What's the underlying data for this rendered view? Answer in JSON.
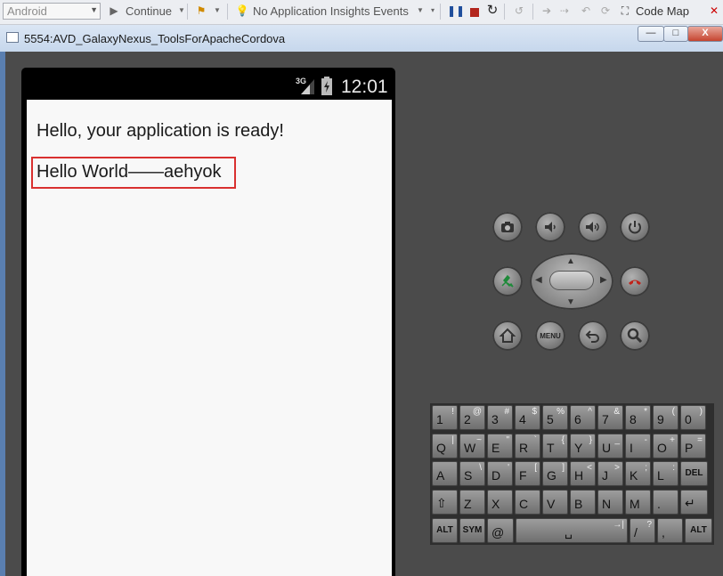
{
  "toolbar": {
    "platform": "Android",
    "continue_label": "Continue",
    "insights_label": "No Application Insights Events",
    "code_map_label": "Code Map"
  },
  "window": {
    "title": "5554:AVD_GalaxyNexus_ToolsForApacheCordova",
    "minimize": "—",
    "maximize": "□",
    "close": "X"
  },
  "device": {
    "network": "3G",
    "time": "12:01",
    "line1": "Hello, your application is ready!",
    "line2": "Hello World——aehyok"
  },
  "controls": {
    "menu": "MENU"
  },
  "keyboard": {
    "rows": [
      [
        {
          "m": "1",
          "s": "!"
        },
        {
          "m": "2",
          "s": "@"
        },
        {
          "m": "3",
          "s": "#"
        },
        {
          "m": "4",
          "s": "$"
        },
        {
          "m": "5",
          "s": "%"
        },
        {
          "m": "6",
          "s": "^"
        },
        {
          "m": "7",
          "s": "&"
        },
        {
          "m": "8",
          "s": "*"
        },
        {
          "m": "9",
          "s": "("
        },
        {
          "m": "0",
          "s": ")"
        }
      ],
      [
        {
          "m": "Q",
          "s": "|"
        },
        {
          "m": "W",
          "s": "~"
        },
        {
          "m": "E",
          "s": "\""
        },
        {
          "m": "R",
          "s": "`"
        },
        {
          "m": "T",
          "s": "{"
        },
        {
          "m": "Y",
          "s": "}"
        },
        {
          "m": "U",
          "s": "_"
        },
        {
          "m": "I",
          "s": "-"
        },
        {
          "m": "O",
          "s": "+"
        },
        {
          "m": "P",
          "s": "="
        }
      ],
      [
        {
          "m": "A",
          "s": ""
        },
        {
          "m": "S",
          "s": "\\"
        },
        {
          "m": "D",
          "s": "'"
        },
        {
          "m": "F",
          "s": "["
        },
        {
          "m": "G",
          "s": "]"
        },
        {
          "m": "H",
          "s": "<"
        },
        {
          "m": "J",
          "s": ">"
        },
        {
          "m": "K",
          "s": ";"
        },
        {
          "m": "L",
          "s": ":"
        },
        {
          "m": "DEL",
          "s": ""
        }
      ],
      [
        {
          "m": "⇧",
          "s": ""
        },
        {
          "m": "Z",
          "s": ""
        },
        {
          "m": "X",
          "s": ""
        },
        {
          "m": "C",
          "s": ""
        },
        {
          "m": "V",
          "s": ""
        },
        {
          "m": "B",
          "s": ""
        },
        {
          "m": "N",
          "s": ""
        },
        {
          "m": "M",
          "s": ""
        },
        {
          "m": ".",
          "s": ""
        },
        {
          "m": "↵",
          "s": ""
        }
      ]
    ],
    "bottom": {
      "alt": "ALT",
      "sym": "SYM",
      "at": "@",
      "space": "␣",
      "slash": "/",
      "q": "?",
      "comma": ",",
      "alt2": "ALT"
    }
  }
}
